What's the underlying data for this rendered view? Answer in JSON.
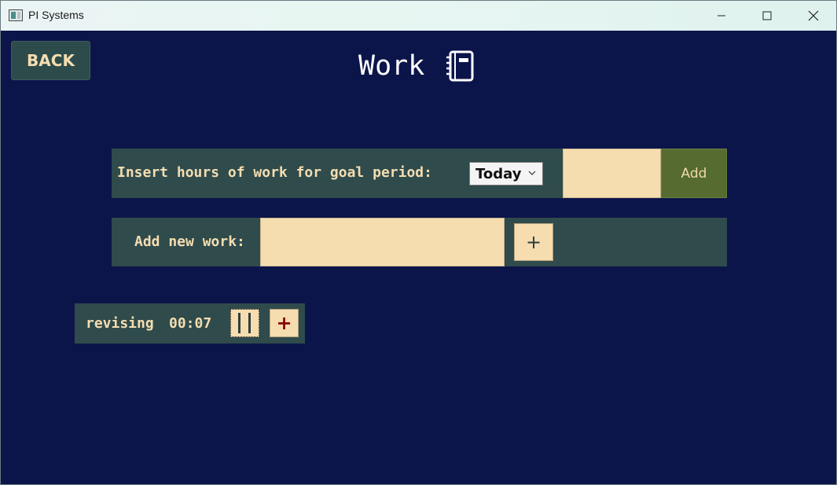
{
  "window": {
    "title": "PI Systems",
    "minimize_icon": "minimize-icon",
    "maximize_icon": "maximize-icon",
    "close_icon": "close-icon"
  },
  "header": {
    "back_label": "BACK",
    "title": "Work",
    "title_icon": "notebook-icon"
  },
  "goal": {
    "label": "Insert hours of work for goal period:",
    "period_selected": "Today",
    "hours_value": "",
    "add_label": "Add"
  },
  "new_work": {
    "label": "Add new work:",
    "name_value": "",
    "add_label": "+"
  },
  "work_items": [
    {
      "name": "revising",
      "time": "00:07",
      "pause_icon": "pause-icon",
      "add_label": "+"
    }
  ],
  "colors": {
    "background": "#0c154a",
    "panel": "#2f4b4c",
    "cream": "#f5ddb0",
    "olive": "#556b2f",
    "item_plus": "#8b0000"
  }
}
